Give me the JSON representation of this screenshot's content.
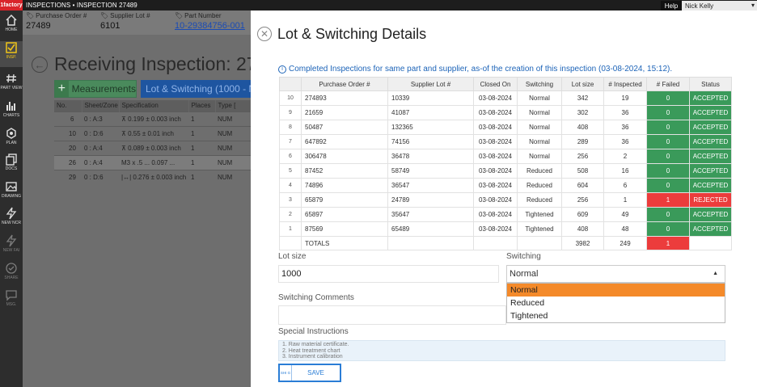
{
  "topbar": {
    "logo": "1factory",
    "breadcrumb": "INSPECTIONS • INSPECTION 27489",
    "help": "Help",
    "user": "Nick Kelly"
  },
  "sidebar": {
    "items": [
      {
        "label": "HOME",
        "icon": "home-icon"
      },
      {
        "label": "INSP.",
        "icon": "checkbox-icon"
      },
      {
        "label": "PART VIEW",
        "icon": "hash-icon"
      },
      {
        "label": "CHARTS",
        "icon": "bar-chart-icon"
      },
      {
        "label": "PLAN",
        "icon": "plan-icon"
      },
      {
        "label": "DOCS",
        "icon": "docs-icon"
      },
      {
        "label": "DRAWING",
        "icon": "image-icon"
      },
      {
        "label": "NEW NCR",
        "icon": "lightning-icon"
      },
      {
        "label": "NEW FAI",
        "icon": "lightning-icon"
      },
      {
        "label": "SHARE",
        "icon": "check-circle-icon"
      },
      {
        "label": "MSG.",
        "icon": "message-icon"
      }
    ]
  },
  "info": {
    "po_label": "Purchase Order #",
    "po_value": "27489",
    "lot_label": "Supplier Lot #",
    "lot_value": "6101",
    "part_label": "Part Number",
    "part_value": "10-29384756-001"
  },
  "background": {
    "title": "Receiving Inspection: 27",
    "measurements_btn": "Measurements",
    "lot_switching_btn": "Lot & Switching (1000 - N",
    "table_headers": [
      "No.",
      "Sheet/Zone",
      "Specification",
      "Places",
      "Type ["
    ],
    "rows": [
      [
        "6",
        "0 : A:3",
        "⊼  0.199 ± 0.003  inch",
        "1",
        "NUM"
      ],
      [
        "10",
        "0 : D:6",
        "⊼  0.55 ± 0.01  inch",
        "1",
        "NUM"
      ],
      [
        "20",
        "0 : A:4",
        "⊼  0.089 ± 0.003  inch",
        "1",
        "NUM"
      ],
      [
        "26",
        "0 : A:4",
        "M3 x .5 ... 0.097 ...",
        "1",
        "NUM"
      ],
      [
        "29",
        "0 : D:6",
        "|↔|  0.276 ± 0.003  inch",
        "1",
        "NUM"
      ]
    ]
  },
  "modal": {
    "title": "Lot & Switching Details",
    "note": "Completed Inspections for same part and supplier, as-of the creation of this inspection (03-08-2024, 15:12).",
    "table": {
      "headers": [
        "",
        "Purchase Order #",
        "Supplier Lot #",
        "Closed On",
        "Switching",
        "Lot size",
        "# Inspected",
        "# Failed",
        "Status"
      ],
      "rows": [
        [
          "10",
          "274893",
          "10339",
          "03-08-2024",
          "Normal",
          "342",
          "19",
          "0",
          "ACCEPTED"
        ],
        [
          "9",
          "21659",
          "41087",
          "03-08-2024",
          "Normal",
          "302",
          "36",
          "0",
          "ACCEPTED"
        ],
        [
          "8",
          "50487",
          "132365",
          "03-08-2024",
          "Normal",
          "408",
          "36",
          "0",
          "ACCEPTED"
        ],
        [
          "7",
          "647892",
          "74156",
          "03-08-2024",
          "Normal",
          "289",
          "36",
          "0",
          "ACCEPTED"
        ],
        [
          "6",
          "306478",
          "36478",
          "03-08-2024",
          "Normal",
          "256",
          "2",
          "0",
          "ACCEPTED"
        ],
        [
          "5",
          "87452",
          "58749",
          "03-08-2024",
          "Reduced",
          "508",
          "16",
          "0",
          "ACCEPTED"
        ],
        [
          "4",
          "74896",
          "36547",
          "03-08-2024",
          "Reduced",
          "604",
          "6",
          "0",
          "ACCEPTED"
        ],
        [
          "3",
          "65879",
          "24789",
          "03-08-2024",
          "Reduced",
          "256",
          "1",
          "1",
          "REJECTED"
        ],
        [
          "2",
          "65897",
          "35647",
          "03-08-2024",
          "Tightened",
          "609",
          "49",
          "0",
          "ACCEPTED"
        ],
        [
          "1",
          "87569",
          "65489",
          "03-08-2024",
          "Tightened",
          "408",
          "48",
          "0",
          "ACCEPTED"
        ]
      ],
      "totals": {
        "label": "TOTALS",
        "lot_size": "3982",
        "inspected": "249",
        "failed": "1"
      }
    },
    "lot_size_label": "Lot size",
    "lot_size_value": "1000",
    "switching_label": "Switching",
    "switching_value": "Normal",
    "switching_options": [
      "Normal",
      "Reduced",
      "Tightened"
    ],
    "comments_label": "Switching Comments",
    "special_label": "Special Instructions",
    "special_lines": [
      "1. Raw material certificate.",
      "2. Heat treatment chart",
      "3. Instrument calibration"
    ],
    "save_shortcut": "SHI G",
    "save_label": "SAVE"
  },
  "colors": {
    "accepted": "#3a9a5a",
    "rejected": "#ec3c3c",
    "highlight_option": "#f48a2a",
    "link_blue": "#1d64b8"
  }
}
